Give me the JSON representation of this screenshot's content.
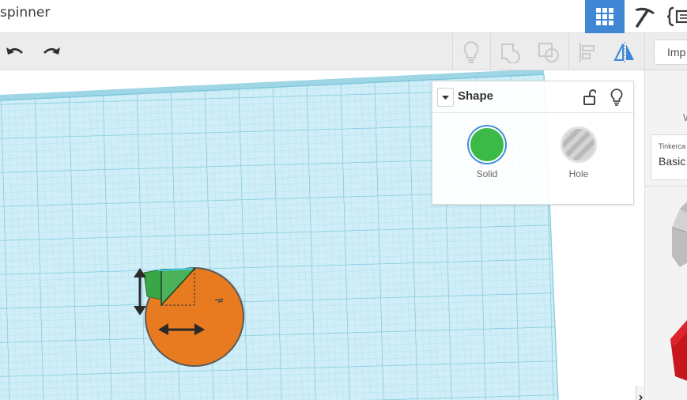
{
  "app": {
    "title": "spinner"
  },
  "header": {
    "view_grid_icon": "grid-view-icon",
    "pickaxe_icon": "pickaxe-icon",
    "codeblocks_icon": "codeblocks-icon"
  },
  "toolbar": {
    "undo_icon": "undo-icon",
    "redo_icon": "redo-icon",
    "import_label": "Imp"
  },
  "inspector": {
    "title": "Shape",
    "options": [
      {
        "label": "Solid",
        "color": "#3cba47"
      },
      {
        "label": "Hole",
        "color": "#c4c4c4"
      }
    ]
  },
  "right_panel": {
    "w_label": "W",
    "library_small": "Tinkerca",
    "library_name": "Basic"
  },
  "colors": {
    "accent": "#3f87d4",
    "workplane": "#cdeef6",
    "grid_line": "#7bc7dc",
    "shape_orange": "#e87b1f",
    "shape_green": "#3aa648"
  }
}
